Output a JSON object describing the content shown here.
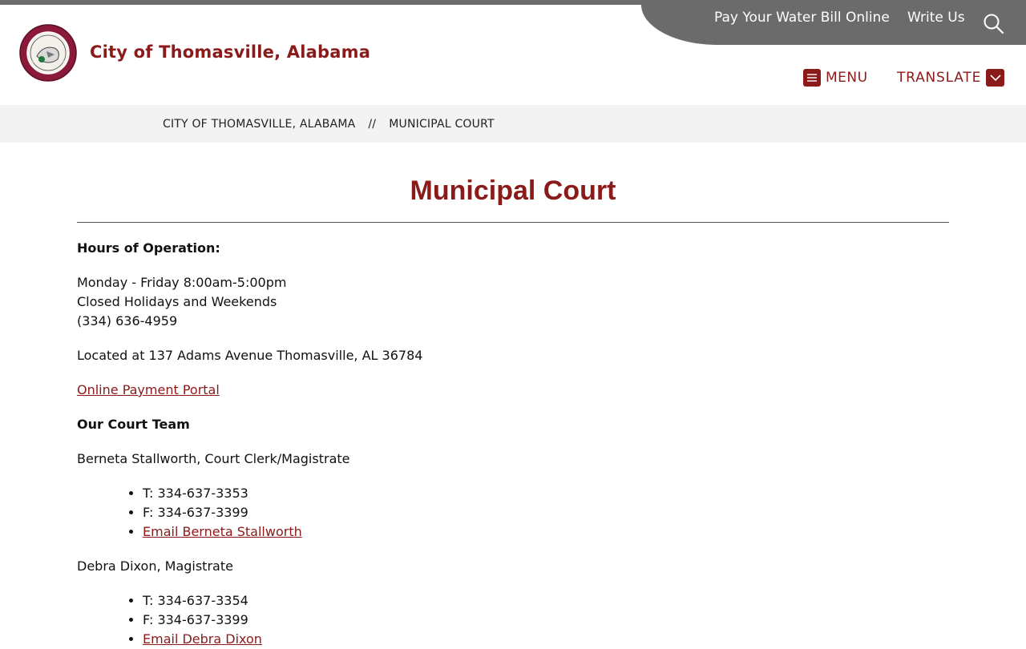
{
  "utility": {
    "pay_water": "Pay Your Water Bill Online",
    "write_us": "Write Us"
  },
  "site": {
    "title": "City of Thomasville, Alabama",
    "brand_color": "#8b1a1a"
  },
  "nav": {
    "menu_label": "MENU",
    "translate_label": "TRANSLATE"
  },
  "breadcrumb": {
    "home": "CITY OF THOMASVILLE, ALABAMA",
    "separator": "//",
    "current": "MUNICIPAL COURT"
  },
  "page": {
    "title": "Municipal Court",
    "hours_heading": "Hours of Operation:",
    "hours_lines": [
      "Monday - Friday 8:00am-5:00pm",
      "Closed Holidays and Weekends",
      "(334) 636-4959"
    ],
    "location": "Located at 137 Adams Avenue Thomasville, AL 36784",
    "payment_link": "Online Payment Portal",
    "team_heading": "Our Court Team",
    "team": [
      {
        "name_title": "Berneta Stallworth, Court Clerk/Magistrate",
        "phone": "T: 334-637-3353",
        "fax": "F: 334-637-3399",
        "email_link": "Email Berneta Stallworth"
      },
      {
        "name_title": "Debra Dixon, Magistrate",
        "phone": "T: 334-637-3354",
        "fax": "F: 334-637-3399",
        "email_link": "Email Debra Dixon"
      }
    ]
  },
  "icons": {
    "logo": "city-seal-icon",
    "search": "search-icon",
    "menu": "hamburger-icon",
    "translate": "chevron-down-icon"
  }
}
